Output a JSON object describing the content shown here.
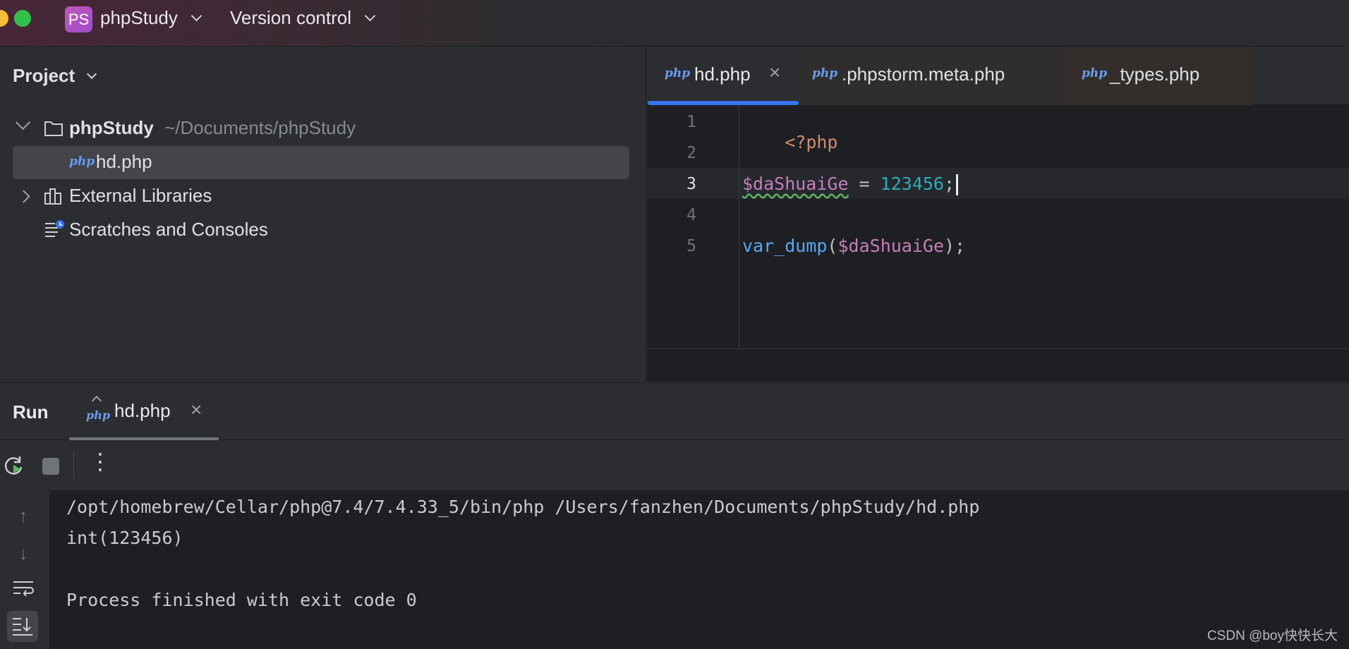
{
  "titlebar": {
    "project_badge": "PS",
    "project_name": "phpStudy",
    "vcs_label": "Version control"
  },
  "project_panel": {
    "title": "Project",
    "tree": {
      "root_name": "phpStudy",
      "root_path": "~/Documents/phpStudy",
      "file": "hd.php",
      "external_libraries": "External Libraries",
      "scratches": "Scratches and Consoles"
    }
  },
  "editor": {
    "tabs": [
      {
        "icon": "php",
        "label": "hd.php",
        "active": true
      },
      {
        "icon": "php",
        "label": ".phpstorm.meta.php",
        "active": false
      },
      {
        "icon": "php",
        "label": "_types.php",
        "active": false
      }
    ],
    "lines": [
      {
        "num": "1",
        "open_tag": "<?php"
      },
      {
        "num": "2"
      },
      {
        "num": "3",
        "var": "$daShuaiGe",
        "op": " = ",
        "num_literal": "123456",
        "semi": ";"
      },
      {
        "num": "4"
      },
      {
        "num": "5",
        "func": "var_dump",
        "lparen": "(",
        "var": "$daShuaiGe",
        "rparen_semi": ");"
      }
    ],
    "current_line": 3
  },
  "run_panel": {
    "title": "Run",
    "tab_label": "hd.php",
    "output": [
      "/opt/homebrew/Cellar/php@7.4/7.4.33_5/bin/php /Users/fanzhen/Documents/phpStudy/hd.php",
      "int(123456)",
      "",
      "Process finished with exit code 0"
    ]
  },
  "watermark": "CSDN @boy快快长大",
  "colors": {
    "accent": "#3574f0",
    "php_tag": "#cf8e6d",
    "variable": "#c77dbb",
    "number": "#2aacb8",
    "function": "#56a8f5",
    "text": "#bcbec4"
  }
}
